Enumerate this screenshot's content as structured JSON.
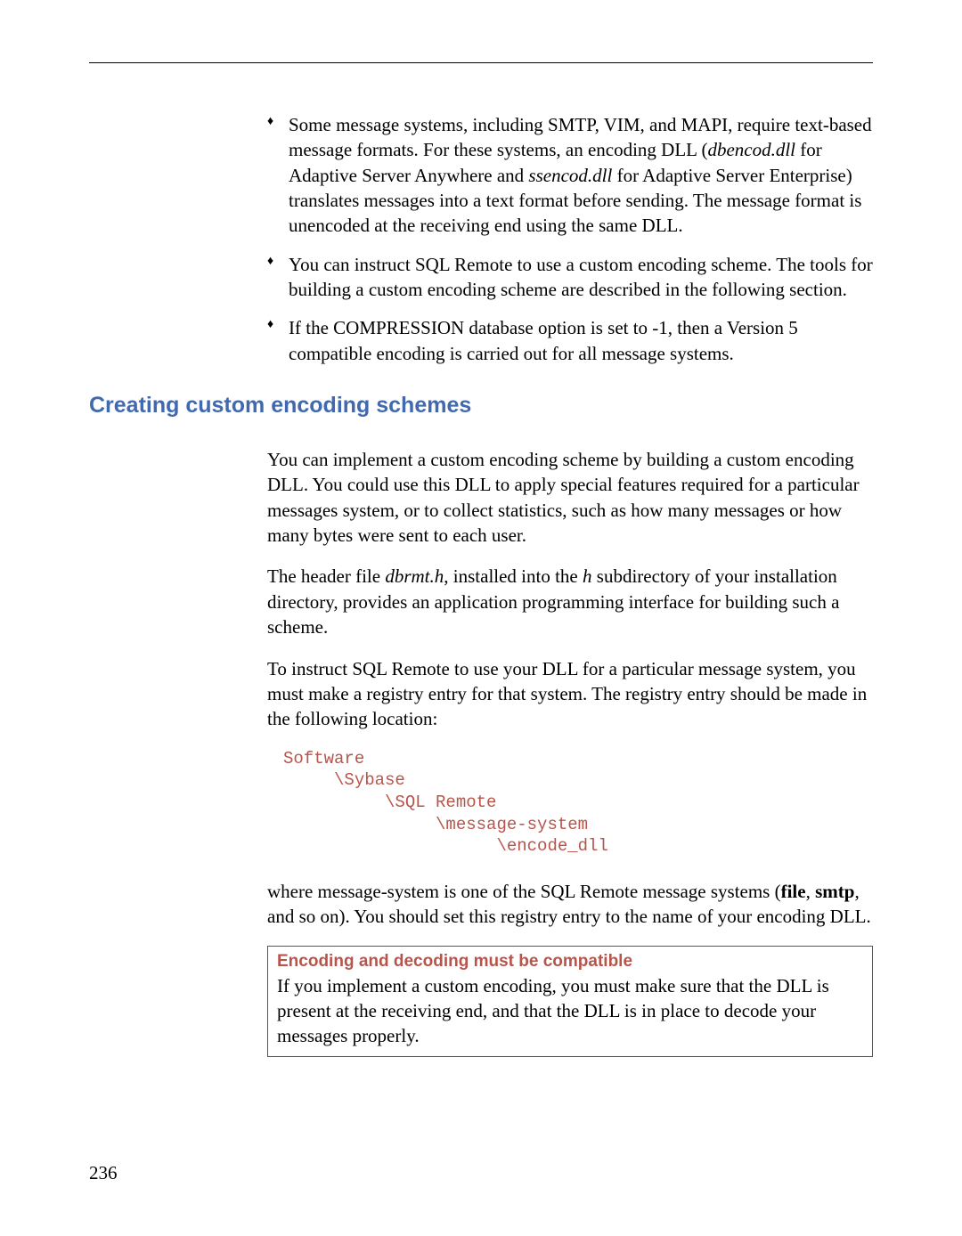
{
  "bullets": {
    "item1_part1": "Some message systems, including SMTP, VIM, and MAPI, require text-based message formats. For these systems, an encoding DLL (",
    "item1_file1": "dbencod.dll",
    "item1_part2": " for Adaptive Server Anywhere and ",
    "item1_file2": "ssencod.dll",
    "item1_part3": " for Adaptive Server Enterprise) translates messages into a text format before sending. The message format is unencoded at the receiving end using the same DLL.",
    "item2": "You can instruct SQL Remote to use a custom encoding scheme. The tools for building a custom encoding scheme are described in the following section.",
    "item3": "If the COMPRESSION database option is set to -1, then a Version 5 compatible encoding is carried out for all message systems."
  },
  "heading": "Creating custom encoding schemes",
  "para1": "You can implement a custom encoding scheme by building a custom encoding DLL. You could use this DLL to apply special features required for a particular messages system, or to collect statistics, such as how many messages or how many bytes were sent to each user.",
  "para2_part1": "The header file ",
  "para2_file": "dbrmt.h",
  "para2_part2": ", installed into the ",
  "para2_dir": "h",
  "para2_part3": " subdirectory of your installation directory, provides an application programming interface for building such a scheme.",
  "para3": "To instruct SQL Remote to use your DLL for a particular message system, you must make a registry entry for that system. The registry entry should be made in the following location:",
  "code": "Software\n     \\Sybase\n          \\SQL Remote\n               \\message-system\n                     \\encode_dll",
  "para4_part1": "where message-system is one of the SQL Remote message systems (",
  "para4_bold1": "file",
  "para4_part2": ", ",
  "para4_bold2": "smtp",
  "para4_part3": ", and so on). You should set this registry entry to the name of your encoding DLL.",
  "note": {
    "title": "Encoding and decoding must be compatible",
    "body": "If you implement a custom encoding, you must make sure that the DLL is present at the receiving end, and that the DLL is in place to decode your messages properly."
  },
  "page_number": "236"
}
